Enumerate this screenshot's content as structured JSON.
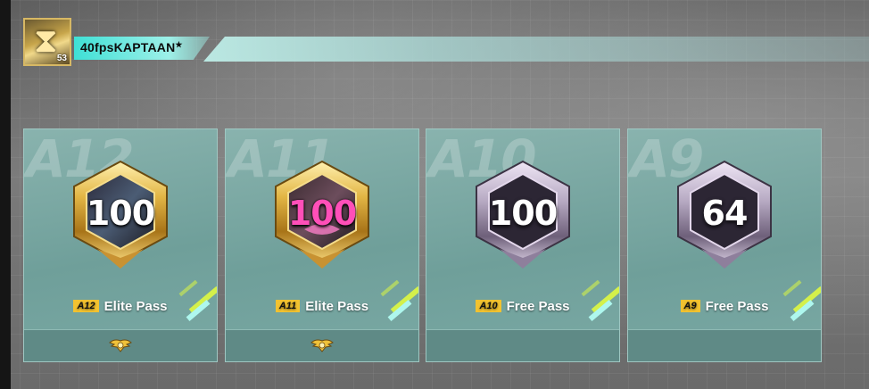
{
  "player": {
    "name": "40fpsKAPTAAN",
    "star": "★",
    "level": "53"
  },
  "passes": [
    {
      "season": "A12",
      "tag": "A12",
      "label": "Elite Pass",
      "level": "100",
      "tier": "gold",
      "has_footer_icon": true
    },
    {
      "season": "A11",
      "tag": "A11",
      "label": "Elite Pass",
      "level": "100",
      "tier": "gold",
      "has_footer_icon": true
    },
    {
      "season": "A10",
      "tag": "A10",
      "label": "Free Pass",
      "level": "100",
      "tier": "silver",
      "has_footer_icon": false
    },
    {
      "season": "A9",
      "tag": "A9",
      "label": "Free Pass",
      "level": "64",
      "tier": "silver",
      "has_footer_icon": false
    }
  ],
  "colors": {
    "accent_cyan": "#3fe0d6",
    "card_teal": "#7aa9a4",
    "tag_yellow": "#f2c230",
    "gold": "#d9a93a",
    "silver": "#b6a9c2"
  },
  "icons": {
    "avatar": "hourglass-icon",
    "footer": "elite-wings-icon"
  }
}
